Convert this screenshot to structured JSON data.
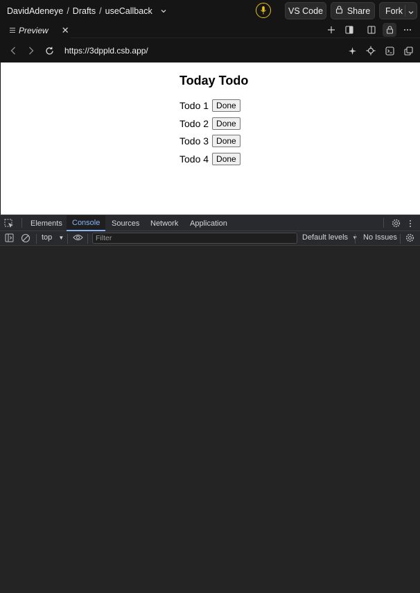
{
  "topbar": {
    "user": "DavidAdeneye",
    "sep": "/",
    "folder": "Drafts",
    "project": "useCallback",
    "vscode_label": "VS Code",
    "share_label": "Share",
    "fork_label": "Fork"
  },
  "tab": {
    "label": "Preview"
  },
  "address": {
    "url": "https://3dppld.csb.app/"
  },
  "preview": {
    "title": "Today Todo",
    "todos": [
      {
        "label": "Todo 1",
        "button": "Done"
      },
      {
        "label": "Todo 2",
        "button": "Done"
      },
      {
        "label": "Todo 3",
        "button": "Done"
      },
      {
        "label": "Todo 4",
        "button": "Done"
      }
    ]
  },
  "devtools": {
    "tabs": [
      "Elements",
      "Console",
      "Sources",
      "Network",
      "Application"
    ],
    "active_tab": "Console",
    "context": "top",
    "filter_placeholder": "Filter",
    "levels": "Default levels",
    "issues": "No Issues"
  },
  "colors": {
    "accent_blue": "#8ab4f8",
    "mic_ring": "#e9c21a"
  }
}
